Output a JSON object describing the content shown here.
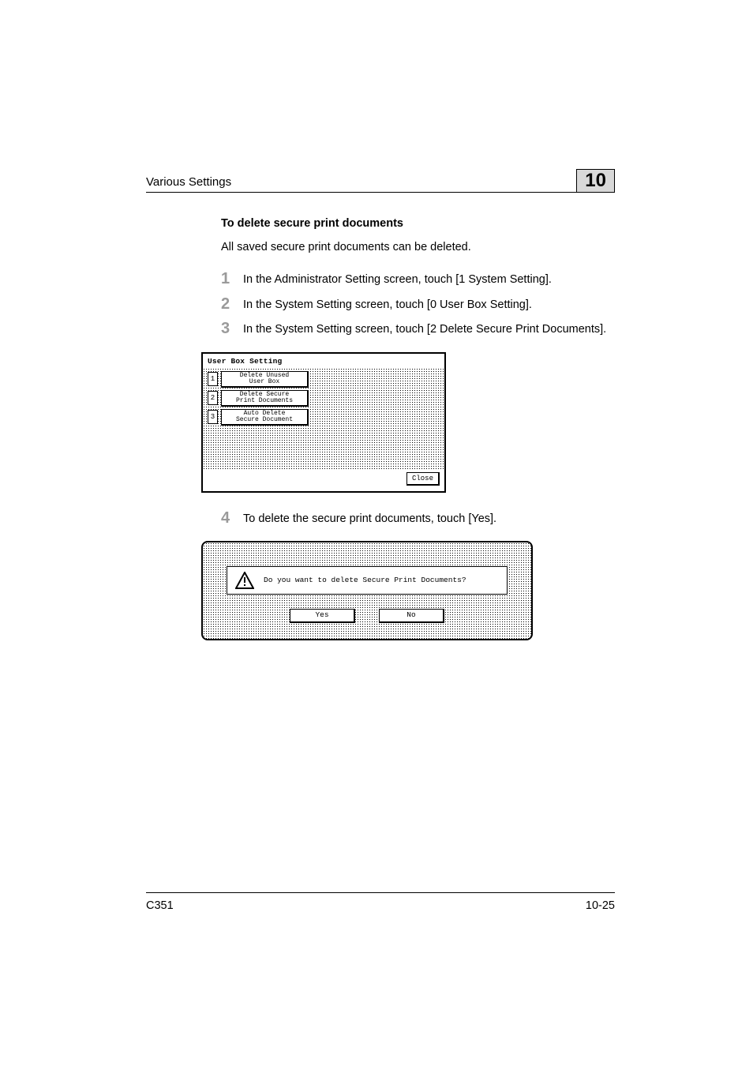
{
  "header": {
    "section": "Various Settings",
    "chapter": "10"
  },
  "section_title": "To delete secure print documents",
  "intro": "All saved secure print documents can be deleted.",
  "steps": [
    {
      "num": "1",
      "text": "In the Administrator Setting screen, touch [1 System Setting]."
    },
    {
      "num": "2",
      "text": "In the System Setting screen, touch [0 User Box Setting]."
    },
    {
      "num": "3",
      "text": "In the System Setting screen, touch [2 Delete Secure Print Documents]."
    },
    {
      "num": "4",
      "text": "To delete the secure print documents, touch [Yes]."
    }
  ],
  "panel1": {
    "title": "User Box Setting",
    "options": [
      {
        "n": "1",
        "line1": "Delete Unused",
        "line2": "User Box"
      },
      {
        "n": "2",
        "line1": "Delete Secure",
        "line2": "Print Documents"
      },
      {
        "n": "3",
        "line1": "Auto Delete",
        "line2": "Secure Document"
      }
    ],
    "close": "Close"
  },
  "panel2": {
    "message": "Do you want to delete Secure Print Documents?",
    "yes": "Yes",
    "no": "No"
  },
  "footer": {
    "model": "C351",
    "page": "10-25"
  }
}
